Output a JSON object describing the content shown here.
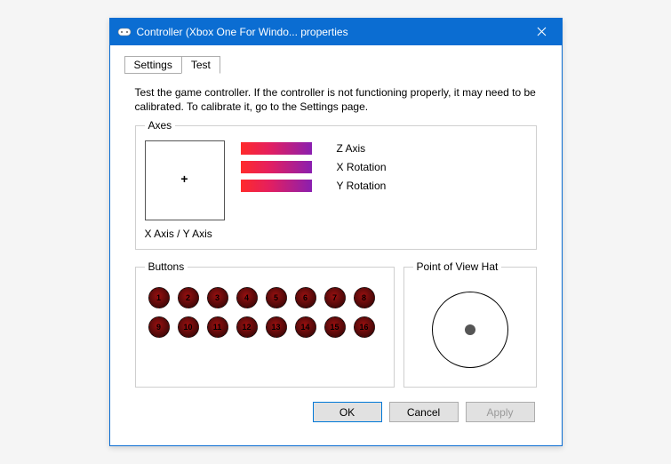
{
  "window": {
    "title": "Controller (Xbox One For Windo... properties"
  },
  "tabs": {
    "settings": "Settings",
    "test": "Test",
    "active": "test"
  },
  "intro": "Test the game controller.  If the controller is not functioning properly, it may need to be calibrated.  To calibrate it, go to the Settings page.",
  "axes": {
    "legend": "Axes",
    "xy_label": "X Axis / Y Axis",
    "bars": [
      {
        "label": "Z Axis"
      },
      {
        "label": "X Rotation"
      },
      {
        "label": "Y Rotation"
      }
    ]
  },
  "buttons_group": {
    "legend": "Buttons",
    "items": [
      "1",
      "2",
      "3",
      "4",
      "5",
      "6",
      "7",
      "8",
      "9",
      "10",
      "11",
      "12",
      "13",
      "14",
      "15",
      "16"
    ]
  },
  "pov": {
    "legend": "Point of View Hat"
  },
  "footer": {
    "ok": "OK",
    "cancel": "Cancel",
    "apply": "Apply"
  }
}
